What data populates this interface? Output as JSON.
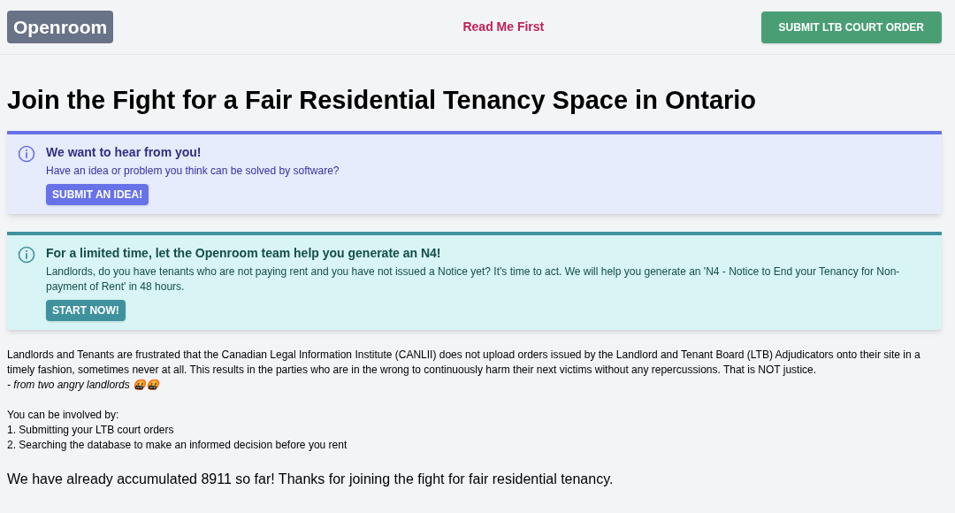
{
  "header": {
    "logo": "Openroom",
    "link": "Read Me First",
    "button": "SUBMIT LTB COURT ORDER"
  },
  "title": "Join the Fight for a Fair Residential Tenancy Space in Ontario",
  "alerts": [
    {
      "kind": "indigo",
      "heading": "We want to hear from you!",
      "text": "Have an idea or problem you think can be solved by software?",
      "button": "SUBMIT AN IDEA!"
    },
    {
      "kind": "teal",
      "heading": "For a limited time, let the Openroom team help you generate an N4!",
      "text": "Landlords, do you have tenants who are not paying rent and you have not issued a Notice yet? It's time to act. We will help you generate an 'N4 - Notice to End your Tenancy for Non-payment of Rent' in 48 hours.",
      "button": "START NOW!"
    }
  ],
  "paragraph": "Landlords and Tenants are frustrated that the Canadian Legal Information Institute (CANLII) does not upload orders issued by the Landlord and Tenant Board (LTB) Adjudicators onto their site in a timely fashion, sometimes never at all. This results in the parties who are in the wrong to continuously harm their next victims without any repercussions. That is NOT justice.",
  "signature": "- from two angry landlords 🤬🤬",
  "involved_heading": "You can be involved by:",
  "involved_items": [
    "1. Submitting your LTB court orders",
    "2. Searching the database to make an informed decision before you rent"
  ],
  "footer": "We have already accumulated 8911 so far! Thanks for joining the fight for fair residential tenancy."
}
